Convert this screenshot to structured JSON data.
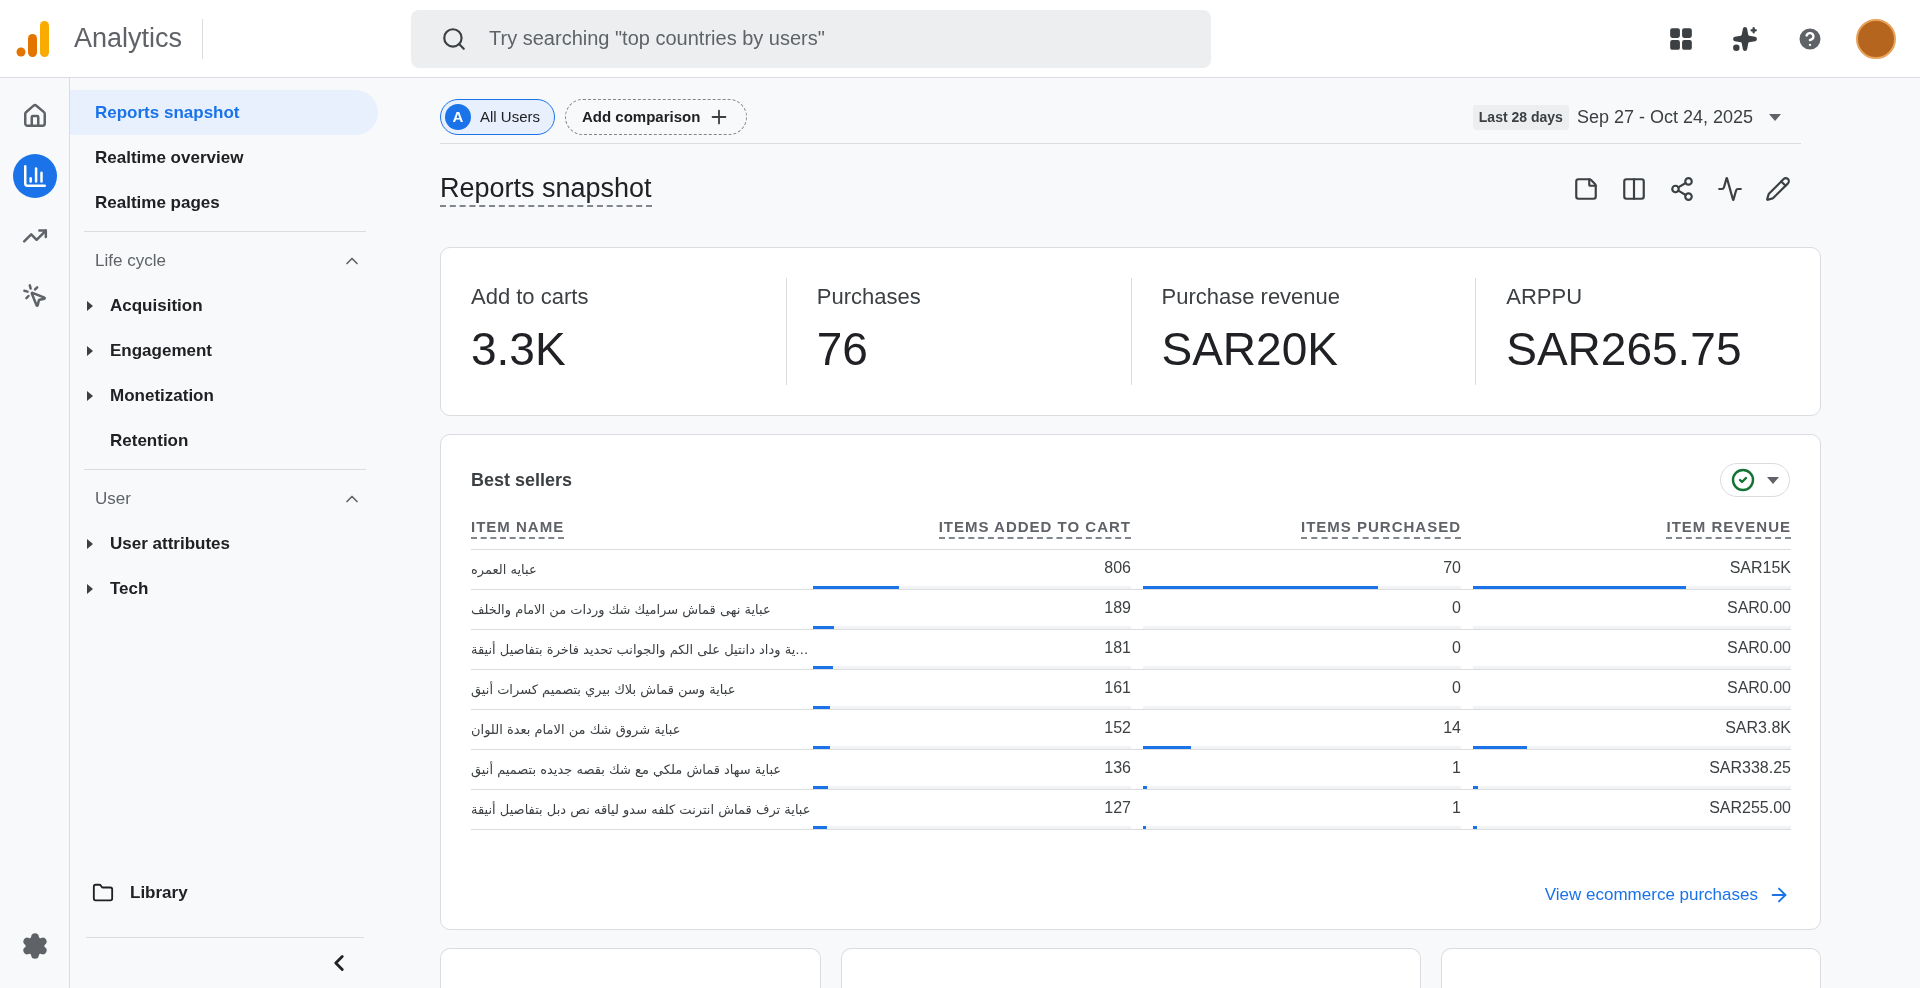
{
  "top_bar": {
    "product": "Analytics",
    "search": {
      "placeholder": "Try searching \"top countries by users\""
    }
  },
  "rail": [
    {
      "kind": "home",
      "selected": false
    },
    {
      "kind": "reports",
      "selected": true
    },
    {
      "kind": "explore",
      "selected": false
    },
    {
      "kind": "advertising",
      "selected": false
    }
  ],
  "nav": {
    "items": [
      {
        "label": "Reports snapshot",
        "selected": true
      },
      {
        "label": "Realtime overview",
        "selected": false
      },
      {
        "label": "Realtime pages",
        "selected": false
      }
    ],
    "sections": [
      {
        "title": "Life cycle",
        "expanded": true,
        "items": [
          {
            "label": "Acquisition",
            "expandable": true
          },
          {
            "label": "Engagement",
            "expandable": true
          },
          {
            "label": "Monetization",
            "expandable": true
          },
          {
            "label": "Retention",
            "expandable": false
          }
        ]
      },
      {
        "title": "User",
        "expanded": true,
        "items": [
          {
            "label": "User attributes",
            "expandable": true
          },
          {
            "label": "Tech",
            "expandable": true
          }
        ]
      }
    ],
    "library": "Library"
  },
  "filters": {
    "segment": {
      "badge": "A",
      "label": "All Users"
    },
    "add_comparison": "Add comparison"
  },
  "date": {
    "range_label": "Last 28 days",
    "range": "Sep 27 - Oct 24, 2025"
  },
  "title": "Reports snapshot",
  "metrics": [
    {
      "label": "Add to carts",
      "value": "3.3K"
    },
    {
      "label": "Purchases",
      "value": "76"
    },
    {
      "label": "Purchase revenue",
      "value": "SAR20K"
    },
    {
      "label": "ARPPU",
      "value": "SAR265.75"
    }
  ],
  "best_sellers": {
    "title": "Best sellers",
    "columns": [
      "ITEM NAME",
      "ITEMS ADDED TO CART",
      "ITEMS PURCHASED",
      "ITEM REVENUE"
    ],
    "rows": [
      {
        "cells": [
          {
            "value": "عبايه العمره"
          },
          {
            "value": "806",
            "level": 0.27
          },
          {
            "value": "70",
            "level": 0.74
          },
          {
            "value": "SAR15K",
            "level": 0.67
          }
        ]
      },
      {
        "cells": [
          {
            "value": "عباية نهى قماش سراميك شك وردات من الامام والخلف"
          },
          {
            "value": "189",
            "level": 0.065
          },
          {
            "value": "0"
          },
          {
            "value": "SAR0.00"
          }
        ]
      },
      {
        "cells": [
          {
            "value": "…ية وداد دانتيل على الكم والجوانب تحديد فاخرة بتفاصيل أنيقة"
          },
          {
            "value": "181",
            "level": 0.062
          },
          {
            "value": "0"
          },
          {
            "value": "SAR0.00"
          }
        ]
      },
      {
        "cells": [
          {
            "value": "عباية وسن قماش بلاك بيري بتصميم كسرات أنيق"
          },
          {
            "value": "161",
            "level": 0.055
          },
          {
            "value": "0"
          },
          {
            "value": "SAR0.00"
          }
        ]
      },
      {
        "cells": [
          {
            "value": "عباية شروق شك من الامام بعدة اللوان"
          },
          {
            "value": "152",
            "level": 0.052
          },
          {
            "value": "14",
            "level": 0.15
          },
          {
            "value": "SAR3.8K",
            "level": 0.17
          }
        ]
      },
      {
        "cells": [
          {
            "value": "عباية سهاد قماش ملكي مع شك بقصه جديده بتصميم أنيق"
          },
          {
            "value": "136",
            "level": 0.047
          },
          {
            "value": "1",
            "level": 0.012
          },
          {
            "value": "SAR338.25",
            "level": 0.015
          }
        ]
      },
      {
        "cells": [
          {
            "value": "عباية ترف قماش انترنت كلفه سدو لياقه نص دبل بتفاصيل أنيقة"
          },
          {
            "value": "127",
            "level": 0.044
          },
          {
            "value": "1",
            "level": 0.01
          },
          {
            "value": "SAR255.00",
            "level": 0.012
          }
        ]
      }
    ],
    "link": "View ecommerce purchases"
  }
}
